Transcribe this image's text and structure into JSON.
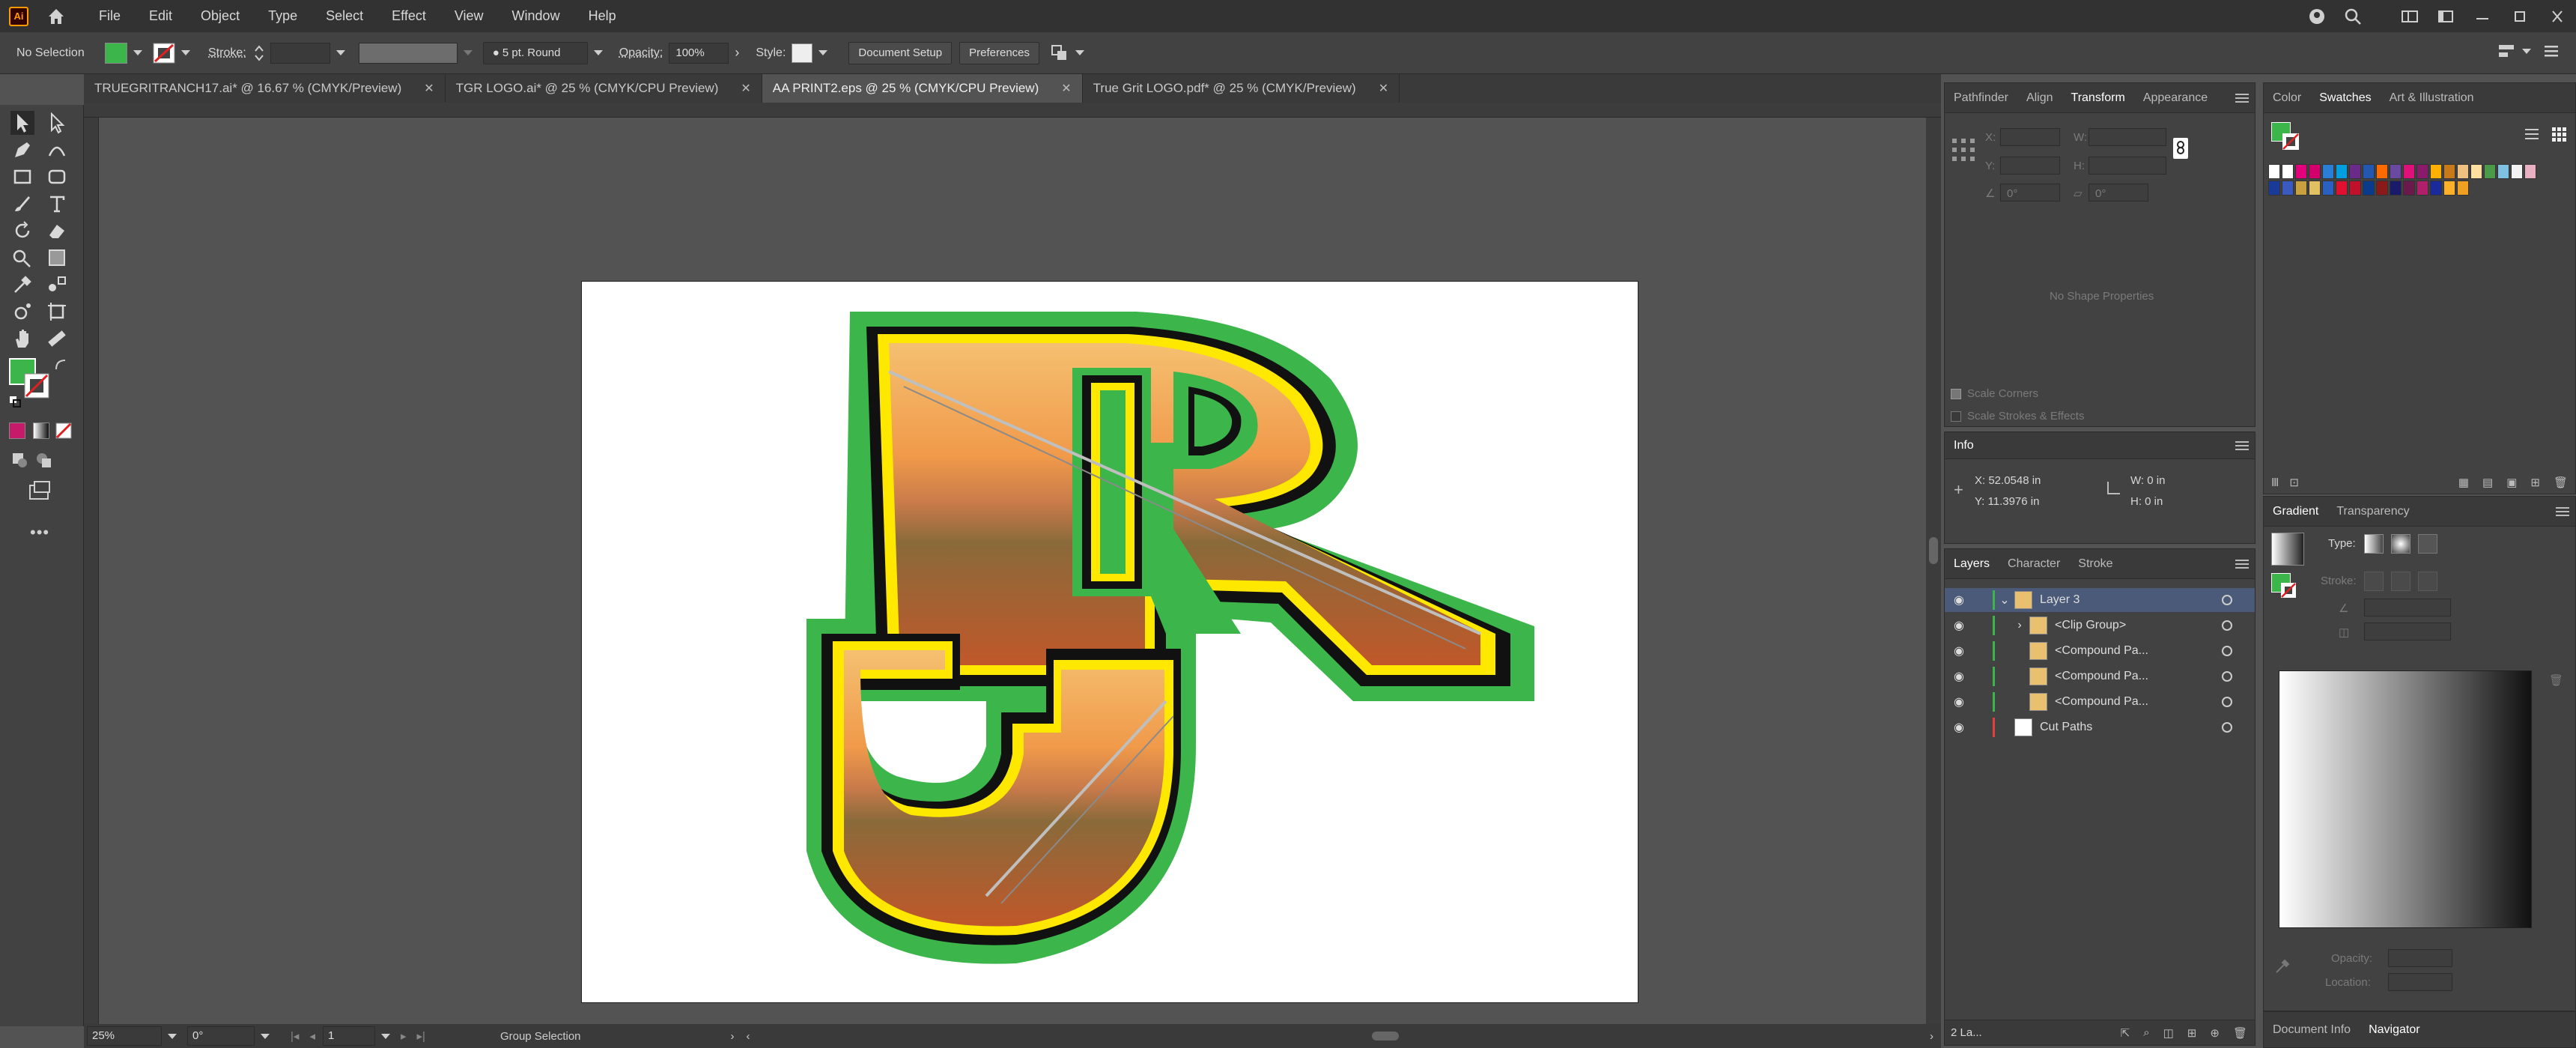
{
  "app": {
    "logo_text": "Ai"
  },
  "menu": [
    "File",
    "Edit",
    "Object",
    "Type",
    "Select",
    "Effect",
    "View",
    "Window",
    "Help"
  ],
  "control_bar": {
    "selection_label": "No Selection",
    "stroke_label": "Stroke:",
    "brush_label": "5 pt. Round",
    "opacity_label": "Opacity:",
    "opacity_value": "100%",
    "style_label": "Style:",
    "document_setup": "Document Setup",
    "preferences": "Preferences",
    "fill_color": "#3cb64a"
  },
  "tabs": [
    {
      "label": "TRUEGRITRANCH17.ai* @ 16.67 % (CMYK/Preview)",
      "active": false
    },
    {
      "label": "TGR LOGO.ai* @ 25 % (CMYK/CPU Preview)",
      "active": false
    },
    {
      "label": "AA PRINT2.eps @ 25 % (CMYK/CPU Preview)",
      "active": true
    },
    {
      "label": "True Grit LOGO.pdf* @ 25 % (CMYK/Preview)",
      "active": false
    }
  ],
  "statusbar": {
    "zoom": "25%",
    "rotation": "0°",
    "artboard": "1",
    "status": "Group Selection"
  },
  "transform_panel": {
    "tabs": [
      "Pathfinder",
      "Align",
      "Transform",
      "Appearance"
    ],
    "active_tab": "Transform",
    "x_label": "X:",
    "y_label": "Y:",
    "w_label": "W:",
    "h_label": "H:",
    "angle_value": "0°",
    "shear_value": "0°",
    "no_shape": "No Shape Properties",
    "scale_corners": "Scale Corners",
    "scale_strokes": "Scale Strokes & Effects"
  },
  "info_panel": {
    "title": "Info",
    "x": "X: 52.0548 in",
    "y": "Y: 11.3976 in",
    "w": "W: 0 in",
    "h": "H: 0 in"
  },
  "layers_panel": {
    "tabs": [
      "Layers",
      "Character",
      "Stroke"
    ],
    "active_tab": "Layers",
    "rows": [
      {
        "name": "Layer 3",
        "indent": 0,
        "color": "#3cb64a",
        "selected": true
      },
      {
        "name": "<Clip Group>",
        "indent": 1,
        "color": "#3cb64a",
        "selected": false
      },
      {
        "name": "<Compound Pa...",
        "indent": 1,
        "color": "#3cb64a",
        "selected": false
      },
      {
        "name": "<Compound Pa...",
        "indent": 1,
        "color": "#3cb64a",
        "selected": false
      },
      {
        "name": "<Compound Pa...",
        "indent": 1,
        "color": "#3cb64a",
        "selected": false
      },
      {
        "name": "Cut Paths",
        "indent": 0,
        "color": "#e04040",
        "selected": false
      }
    ],
    "footer_count": "2 La..."
  },
  "swatches_panel": {
    "tabs": [
      "Color",
      "Swatches",
      "Art & Illustration"
    ],
    "active_tab": "Swatches",
    "row1": [
      "#ffffff",
      "#ffffff",
      "#e4007c",
      "#d1006a",
      "#2a7fd4",
      "#00a0e0",
      "#6a2a8a",
      "#2458b0",
      "#ff6a00",
      "#6a4aa0",
      "#e0107a",
      "#8a1a6a",
      "#ffb000",
      "#c87a1a",
      "#f0c080",
      "#ffe0a0",
      "#4a9a4a",
      "#80c0e0",
      "#f2f2f2",
      "#e8b0c0"
    ],
    "row2": [
      "#1a3a9a",
      "#3a5ac0",
      "#c8a040",
      "#e0c060",
      "#2a60c0",
      "#e01030",
      "#c0102a",
      "#0a3a8a",
      "#8a1a1a",
      "#1a1a6a",
      "#6a1a4a",
      "#b0206a",
      "#1a2a9a",
      "#ffb02a",
      "#f0a020"
    ]
  },
  "gradient_panel": {
    "tabs": [
      "Gradient",
      "Transparency"
    ],
    "active_tab": "Gradient",
    "type_label": "Type:",
    "stroke_label": "Stroke:",
    "opacity_label": "Opacity:",
    "location_label": "Location:"
  },
  "bottom_tabs": [
    "Document Info",
    "Navigator"
  ],
  "bottom_active": "Navigator"
}
